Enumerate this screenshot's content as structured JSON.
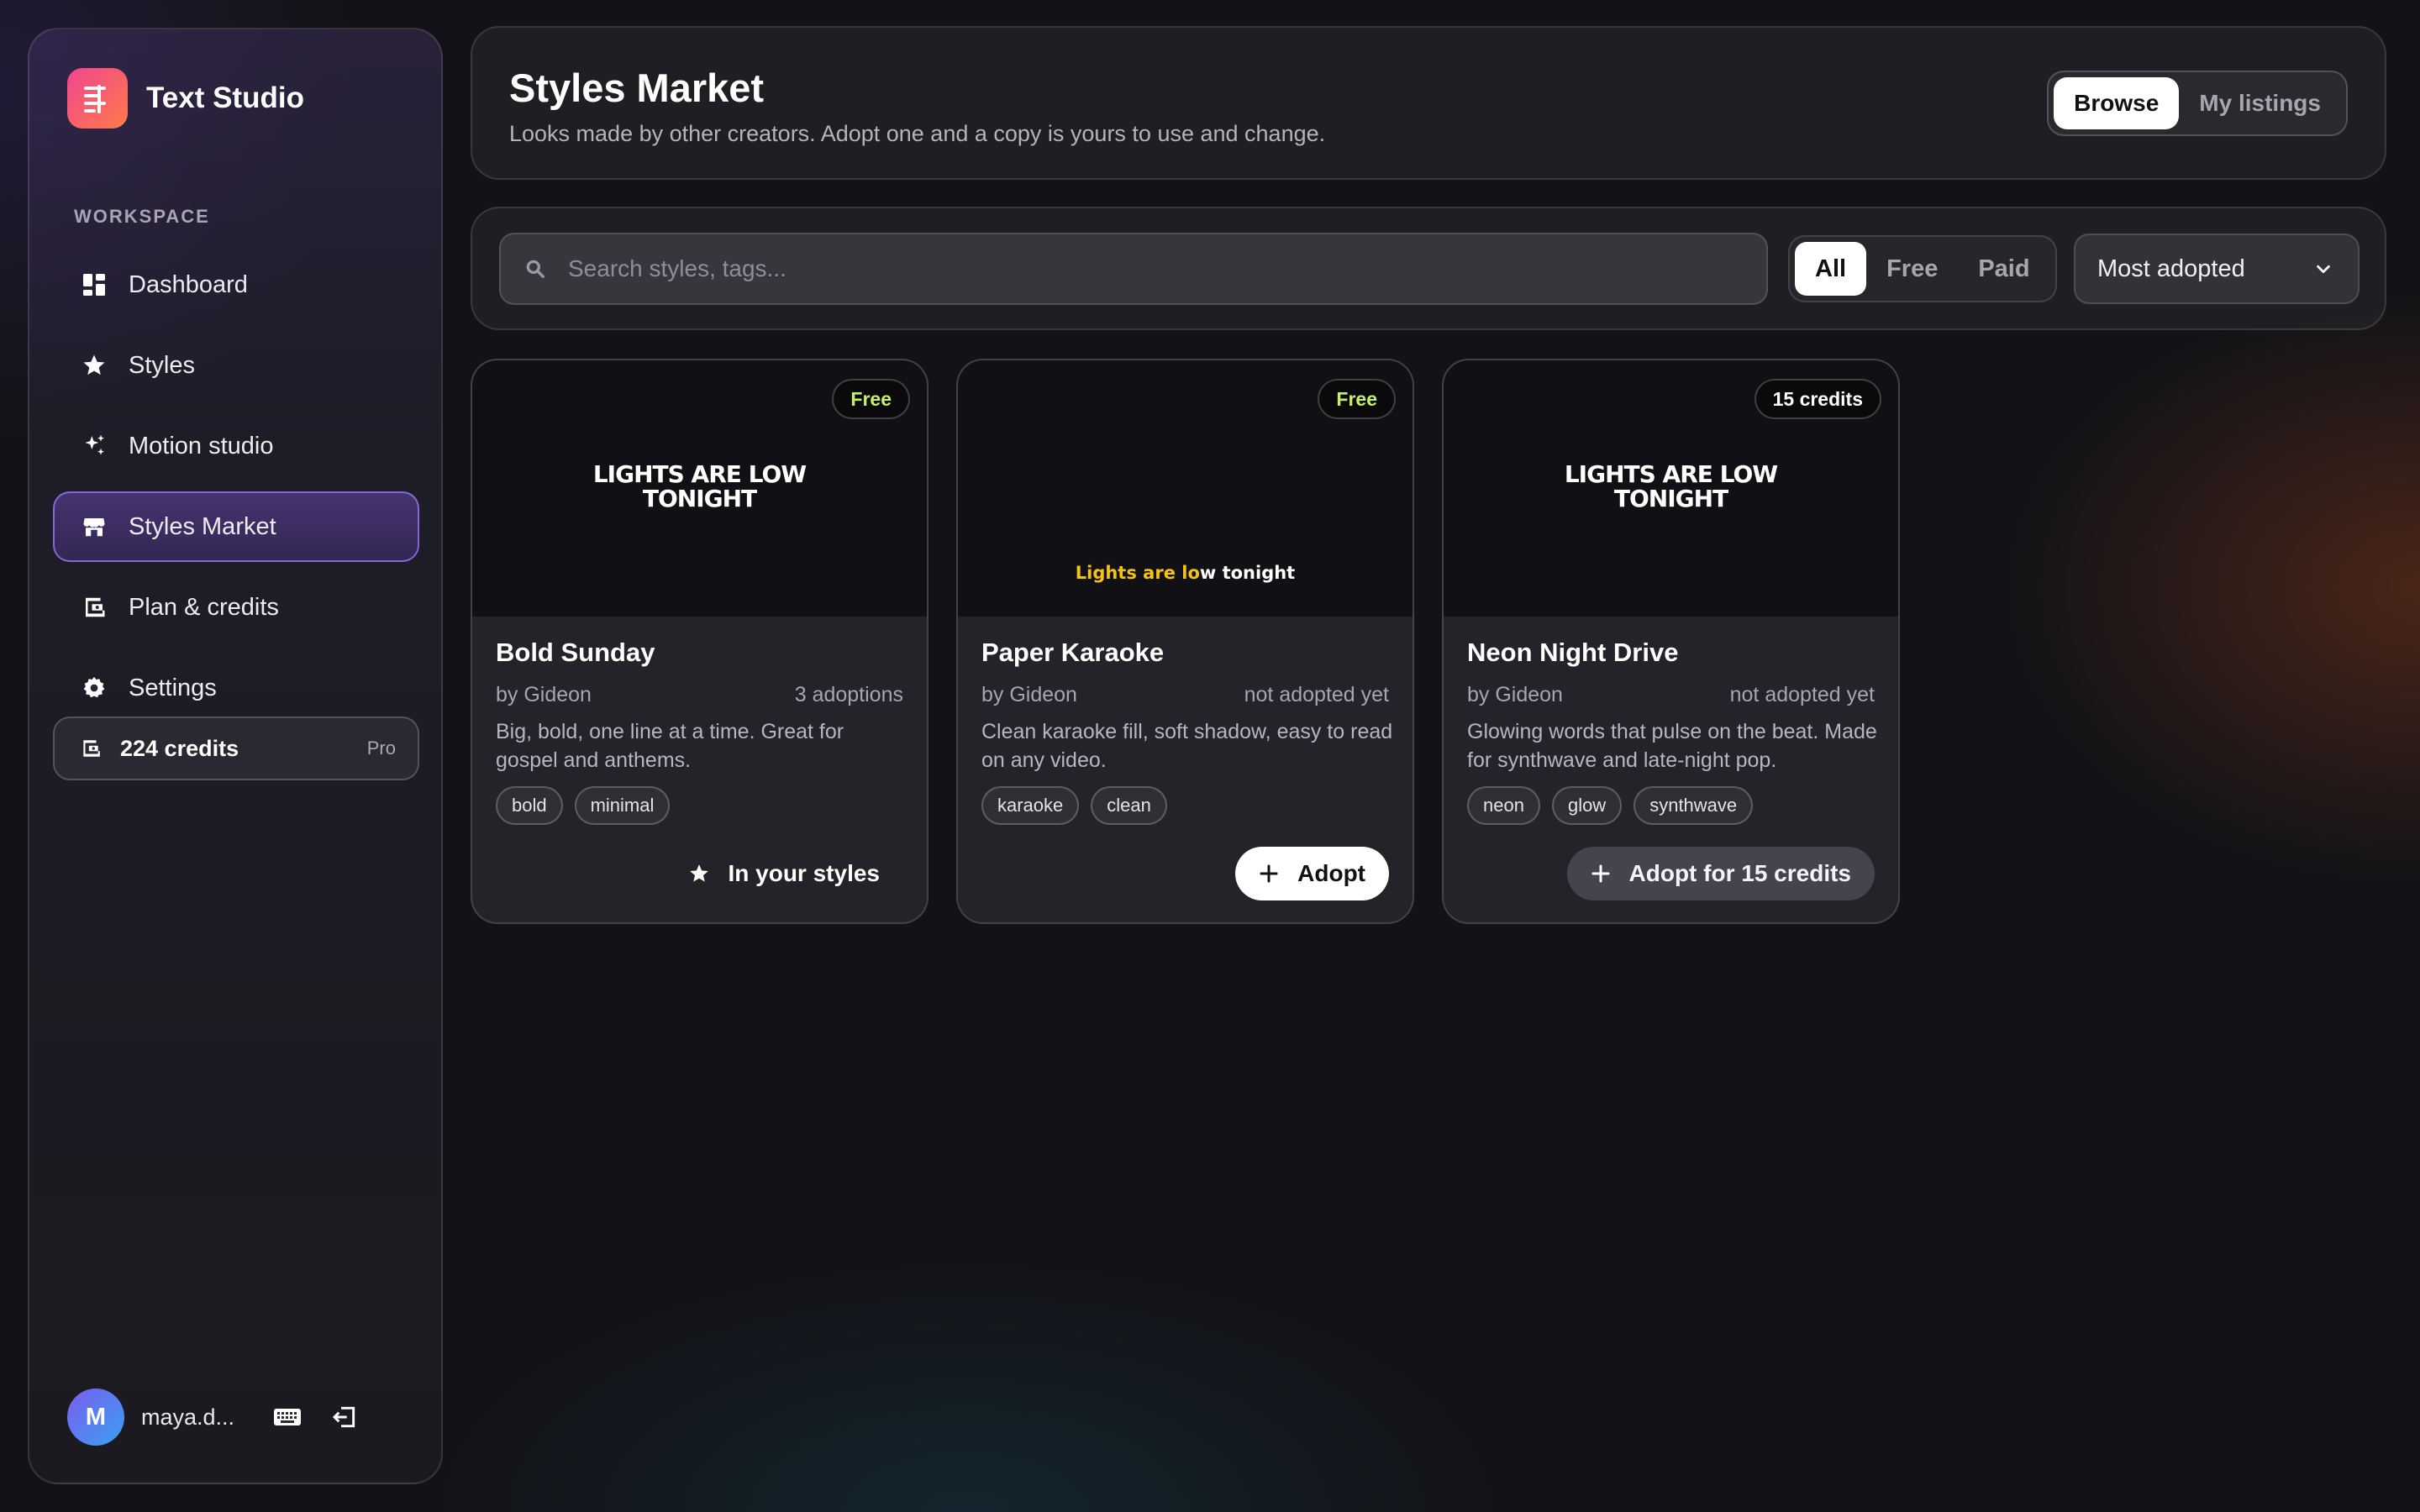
{
  "app": {
    "name": "Text Studio"
  },
  "sidebar": {
    "section_label": "WORKSPACE",
    "items": [
      {
        "label": "Dashboard",
        "icon": "dashboard-icon"
      },
      {
        "label": "Styles",
        "icon": "star-icon"
      },
      {
        "label": "Motion studio",
        "icon": "sparkles-icon"
      },
      {
        "label": "Styles Market",
        "icon": "storefront-icon",
        "active": true
      },
      {
        "label": "Plan & credits",
        "icon": "wallet-icon"
      },
      {
        "label": "Settings",
        "icon": "gear-icon"
      }
    ],
    "credits": {
      "amount": "224 credits",
      "plan": "Pro"
    },
    "user": {
      "initial": "M",
      "name": "maya.d..."
    }
  },
  "header": {
    "title": "Styles Market",
    "subtitle": "Looks made by other creators. Adopt one and a copy is yours to use and change.",
    "view_options": [
      "Browse",
      "My listings"
    ],
    "view_selected": "Browse"
  },
  "filters": {
    "search_placeholder": "Search styles, tags...",
    "price_options": [
      "All",
      "Free",
      "Paid"
    ],
    "price_selected": "All",
    "sort_label": "Most adopted"
  },
  "cards": [
    {
      "badge": "Free",
      "preview_line1": "LIGHTS ARE LOW",
      "preview_line2": "TONIGHT",
      "title": "Bold Sunday",
      "author": "by Gideon",
      "adoptions": "3 adoptions",
      "description": "Big, bold, one line at a time. Great for gospel and anthems.",
      "tags": [
        "bold",
        "minimal"
      ],
      "action": "In your styles"
    },
    {
      "badge": "Free",
      "preview_highlight": "Lights are lo",
      "preview_rest": "w tonight",
      "title": "Paper Karaoke",
      "author": "by Gideon",
      "adoptions": "not adopted yet",
      "description": "Clean karaoke fill, soft shadow, easy to read on any video.",
      "tags": [
        "karaoke",
        "clean"
      ],
      "action": "Adopt"
    },
    {
      "badge": "15 credits",
      "preview_line1": "LIGHTS ARE LOW",
      "preview_line2": "TONIGHT",
      "title": "Neon Night Drive",
      "author": "by Gideon",
      "adoptions": "not adopted yet",
      "description": "Glowing words that pulse on the beat. Made for synthwave and late-night pop.",
      "tags": [
        "neon",
        "glow",
        "synthwave"
      ],
      "action": "Adopt for 15 credits"
    }
  ],
  "colors": {
    "accent_active": "#7a55d6",
    "free_badge": "#c7f06a",
    "karaoke_highlight": "#f5c218",
    "brand_gradient_start": "#f0458f",
    "brand_gradient_end": "#ff7a4a"
  }
}
